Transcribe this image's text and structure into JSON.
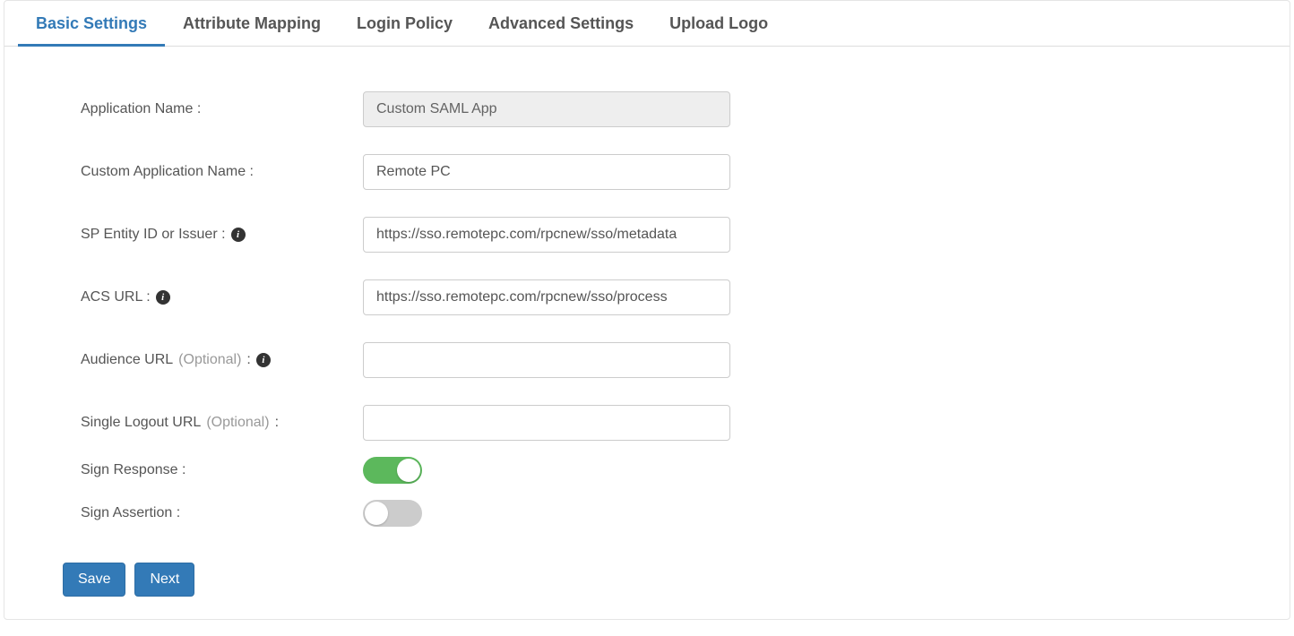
{
  "tabs": [
    {
      "label": "Basic Settings",
      "active": true
    },
    {
      "label": "Attribute Mapping",
      "active": false
    },
    {
      "label": "Login Policy",
      "active": false
    },
    {
      "label": "Advanced Settings",
      "active": false
    },
    {
      "label": "Upload Logo",
      "active": false
    }
  ],
  "form": {
    "app_name_label": "Application Name :",
    "app_name_value": "Custom SAML App",
    "custom_app_label": "Custom Application Name :",
    "custom_app_value": "Remote PC",
    "sp_entity_label": "SP Entity ID or Issuer :",
    "sp_entity_value": "https://sso.remotepc.com/rpcnew/sso/metadata",
    "acs_label": "ACS URL :",
    "acs_value": "https://sso.remotepc.com/rpcnew/sso/process",
    "audience_label_main": "Audience URL ",
    "audience_label_opt": "(Optional)",
    "audience_label_end": " :",
    "audience_value": "",
    "slo_label_main": "Single Logout URL ",
    "slo_label_opt": "(Optional)",
    "slo_label_end": " :",
    "slo_value": "",
    "sign_response_label": "Sign Response :",
    "sign_response_on": true,
    "sign_assertion_label": "Sign Assertion :",
    "sign_assertion_on": false
  },
  "buttons": {
    "save": "Save",
    "next": "Next"
  },
  "icons": {
    "info_glyph": "i"
  }
}
